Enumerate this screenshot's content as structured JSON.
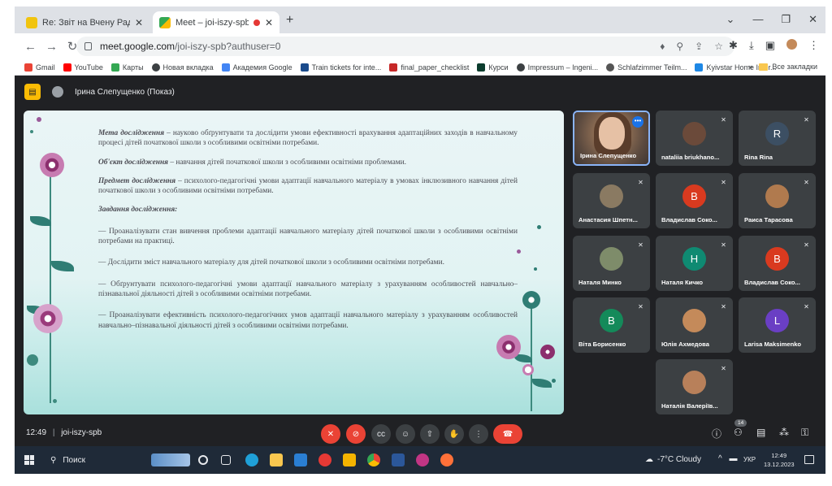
{
  "browser": {
    "tabs": [
      {
        "title": "Re: Звіт на Вчену Раду по ДО -",
        "active": false
      },
      {
        "title": "Meet – joi-iszy-spb",
        "active": true
      }
    ],
    "new_tab": "+",
    "url_host": "meet.google.com",
    "url_path": "/joi-iszy-spb?authuser=0",
    "bookmarks": [
      "Gmail",
      "YouTube",
      "Карты",
      "Новая вкладка",
      "Академия Google",
      "Train tickets for inte...",
      "final_paper_checklist",
      "Курси",
      "Impressum – Ingeni...",
      "Schlafzimmer Teilm...",
      "Kyivstar Home Inter..."
    ],
    "bookmarks_more": "»",
    "all_bookmarks": "Все закладки"
  },
  "meet": {
    "presenter": "Ірина Слепущенко (Показ)",
    "slide": {
      "aim_label": "Мета дослідження",
      "aim_text": " – науково обґрунтувати та дослідити  умови ефективності врахування адаптаційних заходів в навчальному процесі  дітей початкової школи  з особливими освітніми потребами.",
      "object_label": "Об'єкт дослідження",
      "object_text": " – навчання дітей початкової школи з особливими освітніми проблемами.",
      "subject_label": "Предмет дослідження",
      "subject_text": " – психолого-педагогічні умови адаптації навчального матеріалу в умовах інклюзивного навчання дітей початкової школи з особливими освітніми потребами.",
      "tasks_label": "Завдання дослідження:",
      "tasks": [
        "— Проаналізувати стан вивчення проблеми адаптації навчального матеріалу дітей початкової школи з особливими освітніми потребами на практиці.",
        "— Дослідити зміст навчального матеріалу для дітей початкової школи з особливими освітніми потребами.",
        "— Обґрунтувати психолого-педагогічні умови адаптації навчального матеріалу з урахуванням особливостей навчально–пізнавальної діяльності дітей з особливими освітніми потребами.",
        "— Проаналізувати  ефективність психолого-педагогічних умов адаптації навчального матеріалу з урахуванням особливостей навчально–пізнавальної діяльності дітей з особливими освітніми потребами."
      ]
    },
    "participants": [
      {
        "name": "Ірина Слепущенко",
        "kind": "video"
      },
      {
        "name": "nataliia briukhano...",
        "kind": "photo",
        "color": "#6b4a3a"
      },
      {
        "name": "Rina Rina",
        "kind": "letter",
        "letter": "R",
        "color": "#3c4f63"
      },
      {
        "name": "Анастасия Шпетн...",
        "kind": "photo",
        "color": "#8a7a62"
      },
      {
        "name": "Владислав Соко...",
        "kind": "letter",
        "letter": "B",
        "color": "#d93a1f"
      },
      {
        "name": "Раиса Тарасова",
        "kind": "photo",
        "color": "#b07a4e"
      },
      {
        "name": "Наталя Минко",
        "kind": "photo",
        "color": "#7e8c6a"
      },
      {
        "name": "Наталя Кичко",
        "kind": "letter",
        "letter": "H",
        "color": "#0f8a72"
      },
      {
        "name": "Владислав Соко...",
        "kind": "letter",
        "letter": "B",
        "color": "#d93a1f"
      },
      {
        "name": "Віта Борисенко",
        "kind": "letter",
        "letter": "B",
        "color": "#148a5a"
      },
      {
        "name": "Юлія Ахмедова",
        "kind": "photo",
        "color": "#c48a5a"
      },
      {
        "name": "Larisa Maksimenko",
        "kind": "letter",
        "letter": "L",
        "color": "#6a3fc4"
      },
      {
        "name": "Наталія Валеріїв...",
        "kind": "photo",
        "color": "#b8805a"
      }
    ],
    "time": "12:49",
    "separator": "|",
    "code": "joi-iszy-spb",
    "people_count": "14",
    "colors": {
      "accent_blue": "#8ab4f8",
      "mic_off_red": "#ea4335",
      "slide_teal": "#2f7d74"
    }
  },
  "taskbar": {
    "search": "Поиск",
    "weather": "-7°C  Cloudy",
    "lang": "УКР",
    "time": "12:49",
    "date": "13.12.2023"
  }
}
